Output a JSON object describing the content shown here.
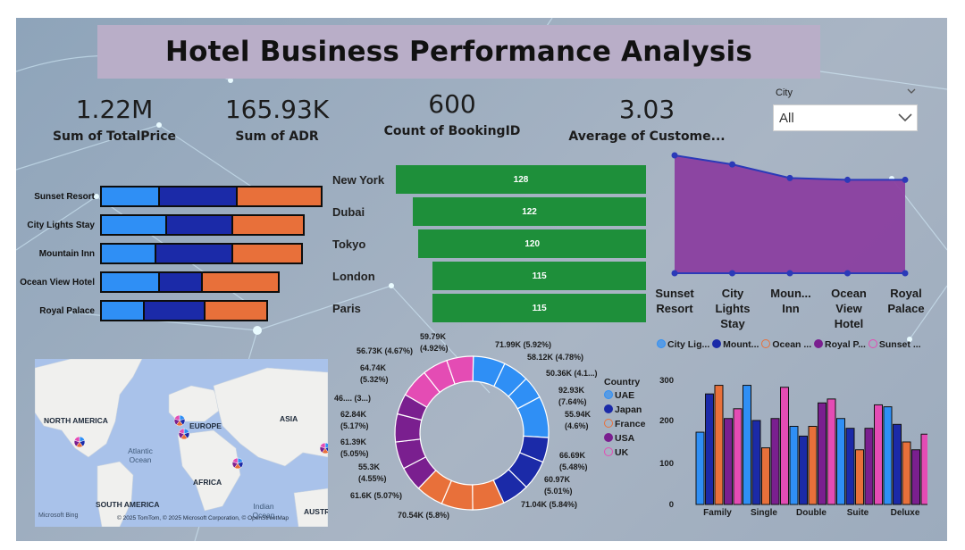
{
  "title": "Hotel Business Performance Analysis",
  "kpis": [
    {
      "value": "1.22M",
      "label": "Sum of TotalPrice"
    },
    {
      "value": "165.93K",
      "label": "Sum of ADR"
    },
    {
      "value": "600",
      "label": "Count of BookingID"
    },
    {
      "value": "3.03",
      "label": "Average of Custome..."
    }
  ],
  "slicer": {
    "label": "City",
    "value": "All"
  },
  "stacked_bar": {
    "hotels": [
      "Sunset Resort",
      "City Lights Stay",
      "Mountain Inn",
      "Ocean View Hotel",
      "Royal Palace"
    ],
    "segments": [
      [
        67,
        87,
        95
      ],
      [
        75,
        74,
        80
      ],
      [
        63,
        86,
        78
      ],
      [
        67,
        48,
        86
      ],
      [
        50,
        68,
        70
      ]
    ],
    "colors": [
      "#2f8ff5",
      "#1b2aa8",
      "#e8703a"
    ]
  },
  "city_bars": {
    "cities": [
      "New York",
      "Dubai",
      "Tokyo",
      "London",
      "Paris"
    ],
    "values": [
      128,
      122,
      120,
      115,
      115
    ]
  },
  "area_chart": {
    "type": "area",
    "categories": [
      "Sunset Resort",
      "City Lights Stay",
      "Moun... Inn",
      "Ocean View Hotel",
      "Royal Palace"
    ],
    "values": [
      130,
      120,
      105,
      103,
      103
    ],
    "legend": [
      "City Lig...",
      "Mount...",
      "Ocean ...",
      "Royal P...",
      "Sunset ..."
    ],
    "legend_colors": [
      "#2f8ff5",
      "#1b2aa8",
      "#e8703a",
      "#7a1f8f",
      "#e44cb4"
    ]
  },
  "donut": {
    "labels": [
      "71.99K (5.92%)",
      "58.12K (4.78%)",
      "50.36K (4.1...)",
      "92.93K (7.64%)",
      "55.94K (4.6%)",
      "66.69K (5.48%)",
      "60.97K (5.01%)",
      "71.04K (5.84%)",
      "70.54K (5.8%)",
      "61.6K (5.07%)",
      "55.3K (4.55%)",
      "61.39K (5.05%)",
      "62.84K (5.17%)",
      "46.... (3...)",
      "64.74K (5.32%)",
      "56.73K (4.67%)",
      "59.79K (4.92%)"
    ],
    "values": [
      71.99,
      58.12,
      50.36,
      92.93,
      55.94,
      66.69,
      60.97,
      71.04,
      70.54,
      61.6,
      55.3,
      61.39,
      62.84,
      46.0,
      64.74,
      56.73,
      59.79
    ],
    "colors": [
      "#2f8ff5",
      "#2f8ff5",
      "#2f8ff5",
      "#2f8ff5",
      "#1b2aa8",
      "#1b2aa8",
      "#1b2aa8",
      "#e8703a",
      "#e8703a",
      "#e8703a",
      "#7a1f8f",
      "#7a1f8f",
      "#7a1f8f",
      "#7a1f8f",
      "#e44cb4",
      "#e44cb4",
      "#e44cb4"
    ],
    "legend_title": "Country",
    "legend": [
      "UAE",
      "Japan",
      "France",
      "USA",
      "UK"
    ],
    "legend_colors": [
      "#2f8ff5",
      "#1b2aa8",
      "#e8703a",
      "#7a1f8f",
      "#e44cb4"
    ]
  },
  "map": {
    "labels": {
      "north_america": "NORTH AMERICA",
      "europe": "EUROPE",
      "asia": "ASIA",
      "africa": "AFRICA",
      "south_america": "SOUTH AMERICA",
      "austr": "AUSTR",
      "atlantic": "Atlantic Ocean",
      "indian": "Indian Ocean"
    },
    "brand": "Microsoft Bing",
    "copyright": "© 2025 TomTom, © 2025 Microsoft Corporation, © OpenStreetMap"
  },
  "chart_data": {
    "type": "bar",
    "categories": [
      "Family",
      "Single",
      "Double",
      "Suite",
      "Deluxe"
    ],
    "series": [
      {
        "name": "City Lig...",
        "values": [
          185,
          305,
          200,
          220,
          250
        ]
      },
      {
        "name": "Mount...",
        "values": [
          283,
          215,
          175,
          195,
          205
        ]
      },
      {
        "name": "Ocean ...",
        "values": [
          305,
          145,
          200,
          140,
          160
        ]
      },
      {
        "name": "Royal P...",
        "values": [
          220,
          220,
          260,
          195,
          140
        ]
      },
      {
        "name": "Sunset ...",
        "values": [
          245,
          300,
          270,
          255,
          180
        ]
      }
    ],
    "yticks": [
      "0",
      "100",
      "200",
      "300"
    ],
    "ylim": [
      0,
      320
    ],
    "colors": [
      "#2f8ff5",
      "#1b2aa8",
      "#e8703a",
      "#7a1f8f",
      "#e44cb4"
    ]
  }
}
